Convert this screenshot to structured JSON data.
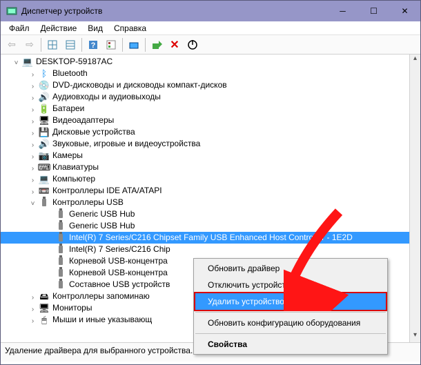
{
  "window": {
    "title": "Диспетчер устройств"
  },
  "menu": {
    "file": "Файл",
    "action": "Действие",
    "view": "Вид",
    "help": "Справка"
  },
  "tree": {
    "root": "DESKTOP-59187AC",
    "bluetooth": "Bluetooth",
    "dvd": "DVD-дисководы и дисководы компакт-дисков",
    "audio": "Аудиовходы и аудиовыходы",
    "battery": "Батареи",
    "video": "Видеоадаптеры",
    "disk": "Дисковые устройства",
    "soundgame": "Звуковые, игровые и видеоустройства",
    "cameras": "Камеры",
    "keyboards": "Клавиатуры",
    "computer": "Компьютер",
    "ide": "Контроллеры IDE ATA/ATAPI",
    "usb": "Контроллеры USB",
    "usb_items": {
      "hub1": "Generic USB Hub",
      "hub2": "Generic USB Hub",
      "intel1": "Intel(R) 7 Series/C216 Chipset Family USB Enhanced Host Controller - 1E2D",
      "intel2": "Intel(R) 7 Series/C216 Chip",
      "roothub1": "Корневой USB-концентра",
      "roothub2": "Корневой USB-концентра",
      "compound": "Составное USB устройств"
    },
    "storage": "Контроллеры запоминаю",
    "monitors": "Мониторы",
    "mice": "Мыши и иные указывающ"
  },
  "context_menu": {
    "update": "Обновить драйвер",
    "disable": "Отключить устройство",
    "remove": "Удалить устройство",
    "refresh": "Обновить конфигурацию оборудования",
    "properties": "Свойства"
  },
  "status": "Удаление драйвера для выбранного устройства."
}
